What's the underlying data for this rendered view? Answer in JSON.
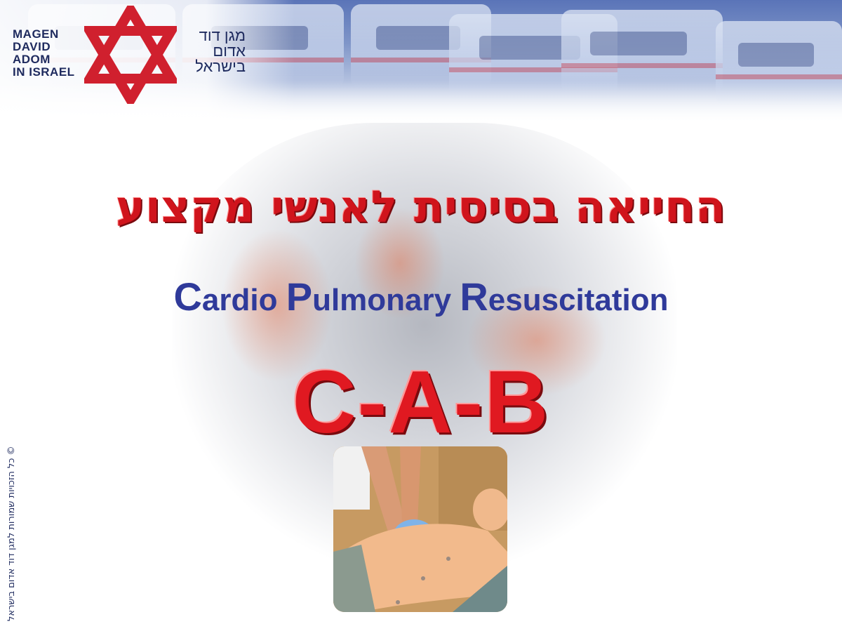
{
  "logo": {
    "en_lines": [
      "MAGEN",
      "DAVID",
      "ADOM",
      "IN ISRAEL"
    ],
    "he_lines": [
      "מגן דוד",
      "אדום",
      "בישראל"
    ],
    "icon": "star-of-david-icon",
    "star_color": "#d0202e",
    "text_color": "#1e2a5e"
  },
  "title_hebrew": "החייאה בסיסית לאנשי מקצוע",
  "title_english": {
    "c": "C",
    "c_rest": "ardio ",
    "p": "P",
    "p_rest": "ulmonary ",
    "r": "R",
    "r_rest": "esuscitation"
  },
  "title_sequence": "C-A-B",
  "copyright": "© כל הזכויות שמורות למגן דוד אדום בישראל",
  "colors": {
    "red": "#d0141c",
    "blue": "#2f3a9a"
  },
  "image": "cpr-compression-photo"
}
